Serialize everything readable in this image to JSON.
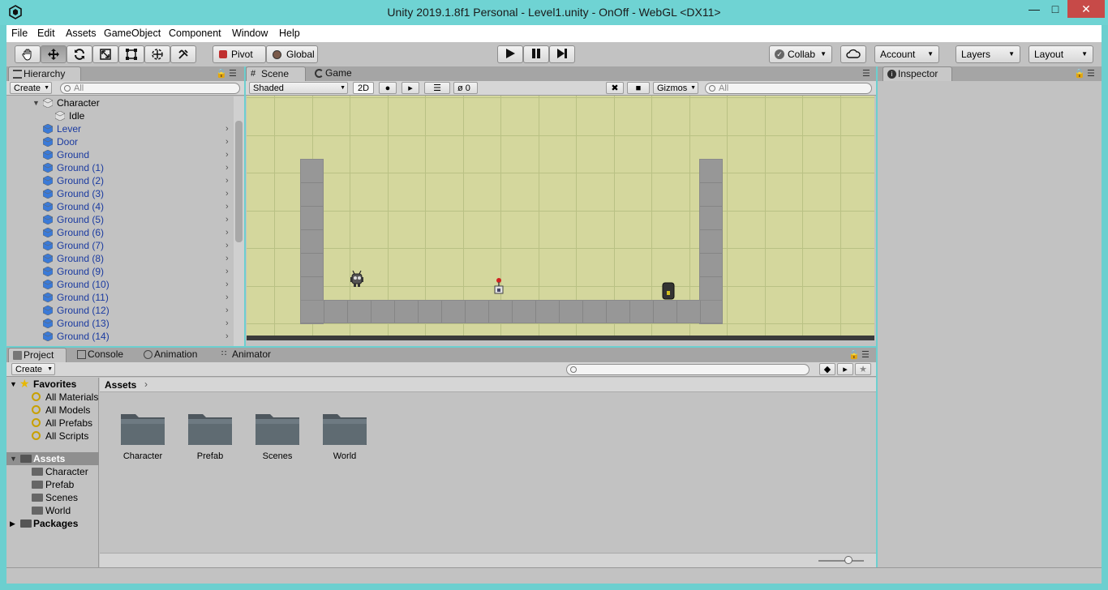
{
  "window": {
    "title": "Unity 2019.1.8f1 Personal - Level1.unity - OnOff - WebGL <DX11>"
  },
  "menu": [
    "File",
    "Edit",
    "Assets",
    "GameObject",
    "Component",
    "Window",
    "Help"
  ],
  "toolbar": {
    "pivot": "Pivot",
    "global": "Global",
    "collab": "Collab",
    "account": "Account",
    "layers": "Layers",
    "layout": "Layout"
  },
  "hierarchy": {
    "tab": "Hierarchy",
    "create": "Create",
    "search_placeholder": "All",
    "items": [
      {
        "label": "Character",
        "indent": 0
      },
      {
        "label": "Idle",
        "indent": 1
      },
      {
        "label": "Lever"
      },
      {
        "label": "Door"
      },
      {
        "label": "Ground"
      },
      {
        "label": "Ground (1)"
      },
      {
        "label": "Ground (2)"
      },
      {
        "label": "Ground (3)"
      },
      {
        "label": "Ground (4)"
      },
      {
        "label": "Ground (5)"
      },
      {
        "label": "Ground (6)"
      },
      {
        "label": "Ground (7)"
      },
      {
        "label": "Ground (8)"
      },
      {
        "label": "Ground (9)"
      },
      {
        "label": "Ground (10)"
      },
      {
        "label": "Ground (11)"
      },
      {
        "label": "Ground (12)"
      },
      {
        "label": "Ground (13)"
      },
      {
        "label": "Ground (14)"
      }
    ]
  },
  "scene": {
    "tab_scene": "Scene",
    "tab_game": "Game",
    "shading": "Shaded",
    "mode_2d": "2D",
    "hidden_count": "0",
    "gizmos": "Gizmos",
    "search_placeholder": "All"
  },
  "inspector": {
    "tab": "Inspector"
  },
  "project": {
    "tabs": [
      "Project",
      "Console",
      "Animation",
      "Animator"
    ],
    "create": "Create",
    "favorites": "Favorites",
    "favorite_items": [
      "All Materials",
      "All Models",
      "All Prefabs",
      "All Scripts"
    ],
    "assets": "Assets",
    "asset_items": [
      "Character",
      "Prefab",
      "Scenes",
      "World"
    ],
    "packages": "Packages",
    "breadcrumb": "Assets",
    "folders": [
      "Character",
      "Prefab",
      "Scenes",
      "World"
    ]
  }
}
